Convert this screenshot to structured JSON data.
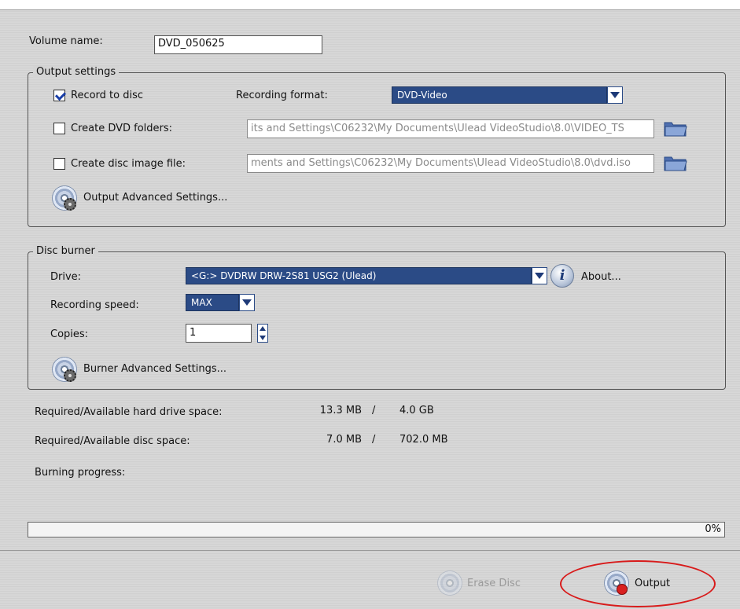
{
  "volume": {
    "label": "Volume name:",
    "value": "DVD_050625"
  },
  "output_settings": {
    "legend": "Output settings",
    "record_to_disc": {
      "label": "Record to disc",
      "checked": true
    },
    "recording_format": {
      "label": "Recording format:",
      "value": "DVD-Video"
    },
    "create_dvd_folders": {
      "label": "Create DVD folders:",
      "checked": false,
      "path": "its and Settings\\C06232\\My Documents\\Ulead VideoStudio\\8.0\\VIDEO_TS"
    },
    "create_disc_image": {
      "label": "Create disc image file:",
      "checked": false,
      "path": "ments and Settings\\C06232\\My Documents\\Ulead VideoStudio\\8.0\\dvd.iso"
    },
    "advanced": "Output Advanced Settings..."
  },
  "disc_burner": {
    "legend": "Disc burner",
    "drive": {
      "label": "Drive:",
      "value": "<G:>  DVDRW DRW-2S81  USG2 (Ulead)"
    },
    "about": "About...",
    "speed": {
      "label": "Recording speed:",
      "value": "MAX"
    },
    "copies": {
      "label": "Copies:",
      "value": "1"
    },
    "advanced": "Burner Advanced Settings..."
  },
  "space": {
    "hard_drive": {
      "label": "Required/Available hard drive space:",
      "required": "13.3 MB",
      "sep": "/",
      "available": "4.0 GB"
    },
    "disc": {
      "label": "Required/Available disc space:",
      "required": "7.0 MB",
      "sep": "/",
      "available": "702.0 MB"
    }
  },
  "burning": {
    "label": "Burning progress:",
    "percent_text": "0%",
    "progress": 0
  },
  "buttons": {
    "erase": "Erase Disc",
    "output": "Output"
  },
  "colors": {
    "accent": "#2b4b86",
    "highlight": "#d81b1b"
  }
}
